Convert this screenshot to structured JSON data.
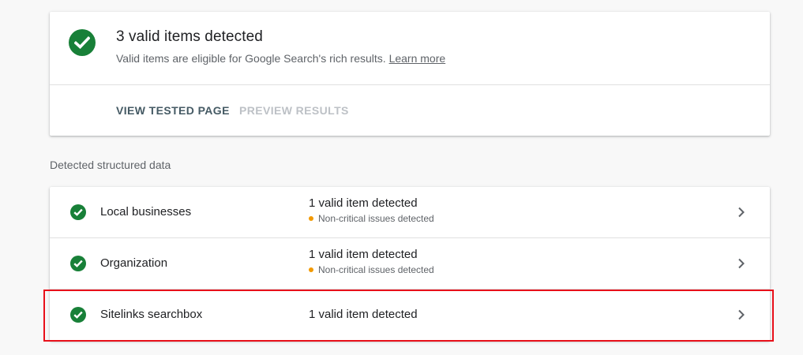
{
  "summary": {
    "title": "3 valid items detected",
    "subtitle": "Valid items are eligible for Google Search's rich results.",
    "learn_more": "Learn more",
    "actions": {
      "view_tested_page": "VIEW TESTED PAGE",
      "preview_results": "PREVIEW RESULTS"
    }
  },
  "section_label": "Detected structured data",
  "items": [
    {
      "name": "Local businesses",
      "status": "1 valid item detected",
      "issue": "Non-critical issues detected"
    },
    {
      "name": "Organization",
      "status": "1 valid item detected",
      "issue": "Non-critical issues detected"
    },
    {
      "name": "Sitelinks searchbox",
      "status": "1 valid item detected"
    }
  ],
  "icons": {
    "valid": "check-circle-icon",
    "row_arrow": "chevron-right-icon",
    "issue_marker": "warning-dot-icon"
  },
  "colors": {
    "valid_green": "#188038",
    "warning_orange": "#f29900",
    "highlight_red": "#e8101a",
    "disabled_gray": "#bdc1c6"
  }
}
